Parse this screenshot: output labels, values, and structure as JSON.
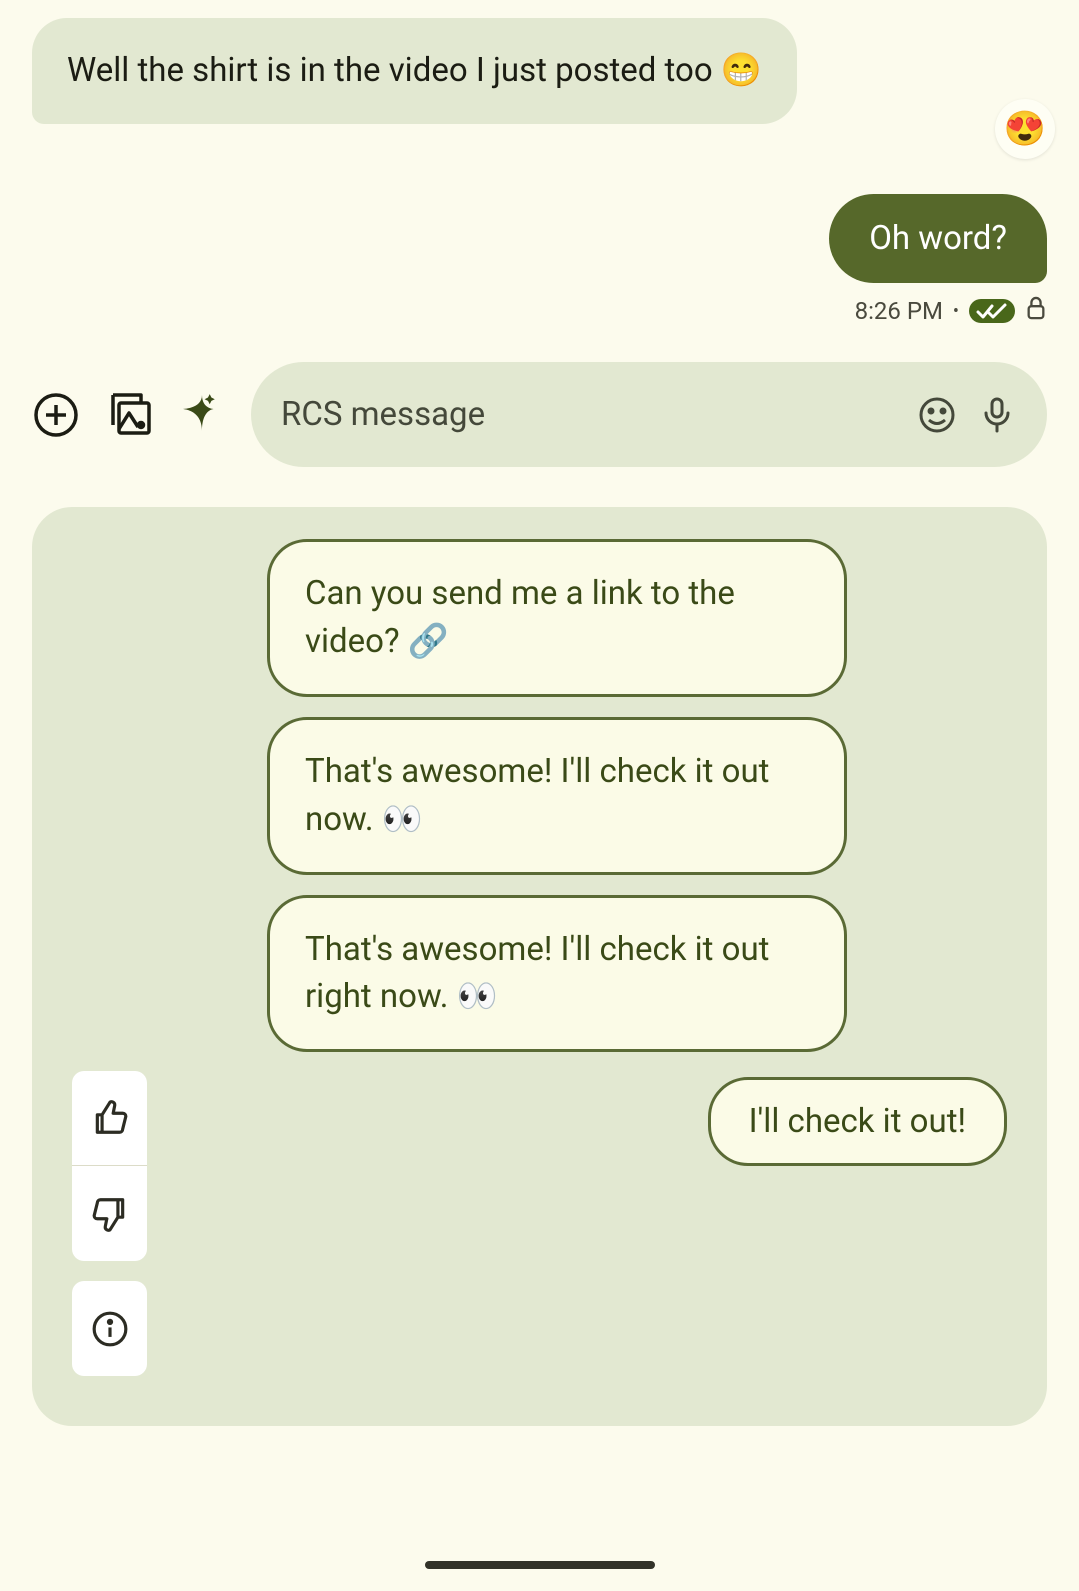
{
  "messages": {
    "incoming": {
      "text": "Well the shirt is in the video I just posted too 😁",
      "reaction": "😍"
    },
    "outgoing": {
      "text": "Oh word?",
      "timestamp": "8:26 PM"
    }
  },
  "input": {
    "placeholder": "RCS message"
  },
  "suggestions": {
    "items": [
      "Can you send me a link to the video? 🔗",
      "That's awesome! I'll check it out now. 👀",
      "That's awesome! I'll check it out right now. 👀"
    ],
    "short": "I'll check it out!"
  }
}
